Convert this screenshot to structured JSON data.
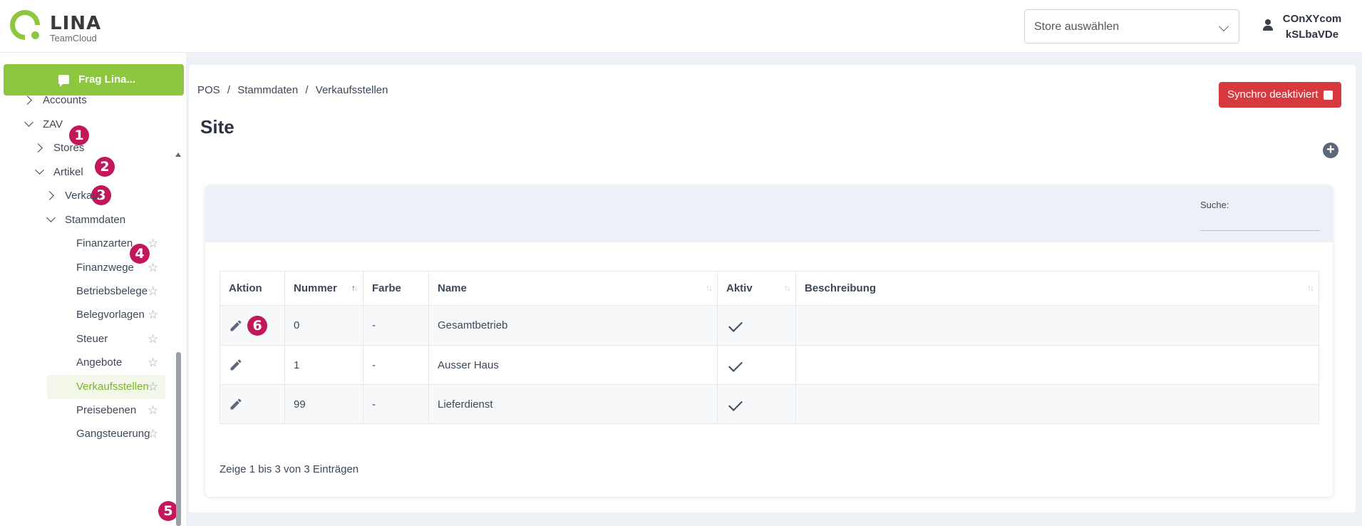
{
  "header": {
    "brand": "LINA",
    "brand_sub": "TeamCloud",
    "store_select": {
      "value": "Store auswählen"
    },
    "user": {
      "line1": "COnXYcom",
      "line2": "kSLbaVDe"
    }
  },
  "sidebar": {
    "ask_button": "Frag Lina...",
    "items": [
      {
        "label": "Accounts",
        "caret": "right"
      },
      {
        "label": "ZAV",
        "caret": "down",
        "badge": "1"
      },
      {
        "label": "Stores",
        "caret": "right",
        "badge": "2"
      },
      {
        "label": "Artikel",
        "caret": "down",
        "badge": "3"
      },
      {
        "label": "Verkauf",
        "caret": "right"
      },
      {
        "label": "Stammdaten",
        "caret": "down",
        "badge": "4"
      },
      {
        "label": "Finanzarten"
      },
      {
        "label": "Finanzwege"
      },
      {
        "label": "Betriebsbelege"
      },
      {
        "label": "Belegvorlagen"
      },
      {
        "label": "Steuer"
      },
      {
        "label": "Angebote"
      },
      {
        "label": "Verkaufsstellen",
        "active": true,
        "badge": "5"
      },
      {
        "label": "Preisebenen"
      },
      {
        "label": "Gangsteuerung"
      }
    ]
  },
  "breadcrumb": [
    "POS",
    "/",
    "Stammdaten",
    "/",
    "Verkaufsstellen"
  ],
  "sync_button": "Synchro deaktiviert",
  "page_title": "Site",
  "search": {
    "label": "Suche:",
    "value": ""
  },
  "table": {
    "columns": [
      "Aktion",
      "Nummer",
      "Farbe",
      "Name",
      "Aktiv",
      "Beschreibung"
    ],
    "rows": [
      {
        "nummer": "0",
        "farbe": "-",
        "name": "Gesamtbetrieb",
        "aktiv": true,
        "beschreibung": "",
        "badge": "6"
      },
      {
        "nummer": "1",
        "farbe": "-",
        "name": "Ausser Haus",
        "aktiv": true,
        "beschreibung": ""
      },
      {
        "nummer": "99",
        "farbe": "-",
        "name": "Lieferdienst",
        "aktiv": true,
        "beschreibung": ""
      }
    ]
  },
  "footer_info": "Zeige 1 bis 3 von 3 Einträgen",
  "colors": {
    "brand_green": "#8dc63f",
    "danger": "#d63a3f",
    "badge": "#c2185b",
    "icon_gray": "#5c6779"
  }
}
